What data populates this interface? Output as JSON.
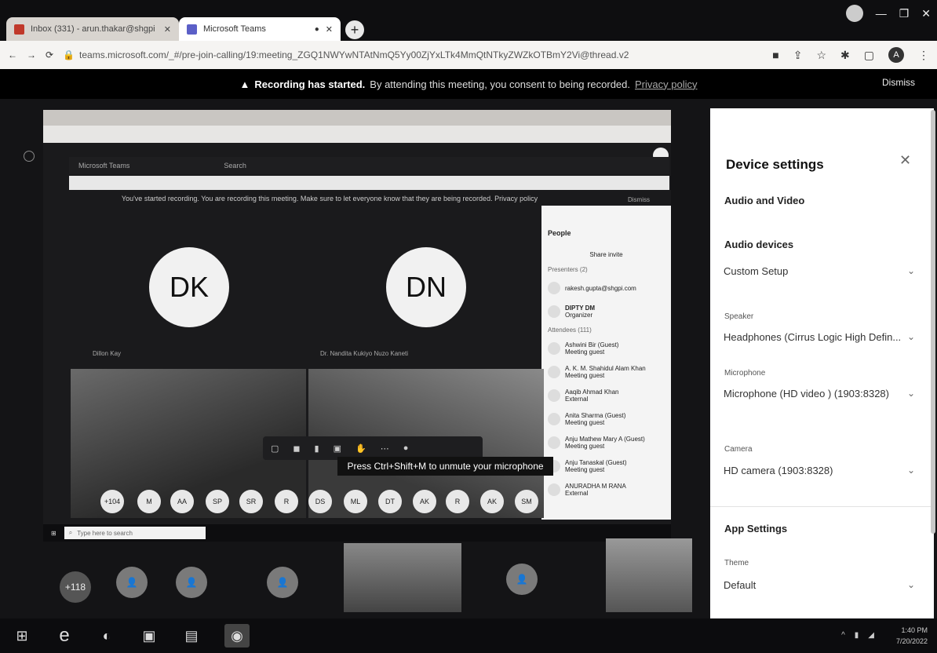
{
  "browser": {
    "tabs": [
      {
        "label": "Inbox (331) - arun.thakar@shgpi",
        "active": false
      },
      {
        "label": "Microsoft Teams",
        "active": true
      }
    ],
    "url": "teams.microsoft.com/_#/pre-join-calling/19:meeting_ZGQ1NWYwNTAtNmQ5Yy00ZjYxLTk4MmQtNTkyZWZkOTBmY2Vi@thread.v2"
  },
  "banner": {
    "bold": "Recording has started.",
    "text": "By attending this meeting, you consent to being recorded.",
    "link": "Privacy policy",
    "dismiss": "Dismiss"
  },
  "shared_screen": {
    "app_name": "Microsoft Teams",
    "search": "Search",
    "recording_text": "You've started recording. You are recording this meeting. Make sure to let everyone know that they are being recorded. Privacy policy",
    "dismiss": "Dismiss",
    "participants": [
      {
        "initials": "DK",
        "name": "Dillon Kay"
      },
      {
        "initials": "DN",
        "name": "Dr. Nandita Kukiyo Nuzo Kaneti"
      }
    ],
    "people_panel": {
      "title": "People",
      "share_invite": "Share invite",
      "presenters": "Presenters (2)",
      "attendees": "Attendees (111)",
      "entries": [
        {
          "name": "rakesh.gupta@shgpi.com",
          "role": ""
        },
        {
          "name": "DIPTY DM",
          "role": "Organizer"
        },
        {
          "name": "Ashwini Bir (Guest)",
          "role": "Meeting guest"
        },
        {
          "name": "A. K. M. Shahidul Alam Khan",
          "role": "Meeting guest"
        },
        {
          "name": "Aaqib Ahmad Khan",
          "role": "External"
        },
        {
          "name": "Anita Sharma (Guest)",
          "role": "Meeting guest"
        },
        {
          "name": "Anju Mathew Mary A (Guest)",
          "role": "Meeting guest"
        },
        {
          "name": "Anju Tanaskal (Guest)",
          "role": "Meeting guest"
        },
        {
          "name": "ANURADHA M RANA",
          "role": "External"
        }
      ]
    },
    "tooltip": "Press Ctrl+Shift+M to unmute your microphone",
    "bubbles": [
      "+104",
      "M",
      "AA",
      "SP",
      "SR",
      "R",
      "DS",
      "ML",
      "DT",
      "AK",
      "R",
      "AK",
      "SM"
    ],
    "taskbar_search": "Type here to search"
  },
  "gallery": {
    "overflow_count": "+118"
  },
  "device_settings": {
    "title": "Device settings",
    "section_av": "Audio and Video",
    "audio_devices_label": "Audio devices",
    "audio_devices_value": "Custom Setup",
    "speaker_label": "Speaker",
    "speaker_value": "Headphones (Cirrus Logic High Defin...",
    "microphone_label": "Microphone",
    "microphone_value": "Microphone (HD video ) (1903:8328)",
    "camera_label": "Camera",
    "camera_value": "HD camera (1903:8328)",
    "app_settings": "App Settings",
    "theme_label": "Theme",
    "theme_value": "Default"
  },
  "taskbar": {
    "time": "1:40 PM",
    "date": "7/20/2022"
  }
}
